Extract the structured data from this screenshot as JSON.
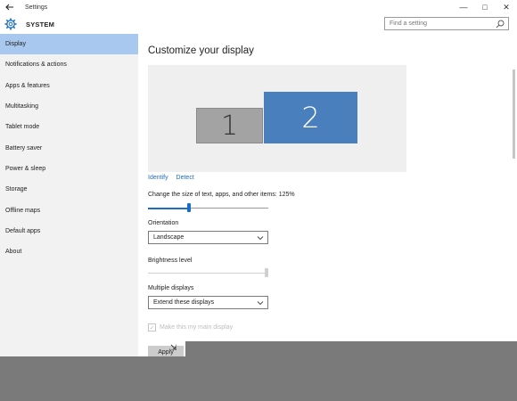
{
  "window": {
    "title": "Settings"
  },
  "titlebar": {
    "back_icon": "back-arrow-icon",
    "minimize": "—",
    "maximize": "□",
    "close": "✕"
  },
  "header": {
    "section": "SYSTEM",
    "search_placeholder": "Find a setting"
  },
  "sidebar": {
    "items": [
      {
        "label": "Display",
        "active": true
      },
      {
        "label": "Notifications & actions"
      },
      {
        "label": "Apps & features"
      },
      {
        "label": "Multitasking"
      },
      {
        "label": "Tablet mode"
      },
      {
        "label": "Battery saver"
      },
      {
        "label": "Power & sleep"
      },
      {
        "label": "Storage"
      },
      {
        "label": "Offline maps"
      },
      {
        "label": "Default apps"
      },
      {
        "label": "About"
      }
    ]
  },
  "main": {
    "title": "Customize your display",
    "monitors": [
      {
        "label": "1"
      },
      {
        "label": "2",
        "selected": true
      }
    ],
    "links": {
      "identify": "Identify",
      "detect": "Detect"
    },
    "scale": {
      "label": "Change the size of text, apps, and other items: 125%",
      "value_fraction": 0.34
    },
    "orientation": {
      "label": "Orientation",
      "value": "Landscape"
    },
    "brightness": {
      "label": "Brightness level",
      "value_fraction": 1.0
    },
    "multiple_displays": {
      "label": "Multiple displays",
      "value": "Extend these displays"
    },
    "main_display_checkbox": {
      "label": "Make this my main display",
      "checked": true,
      "disabled": true
    },
    "apply_button": {
      "label": "Apply"
    }
  },
  "colors": {
    "accent": "#1a6fc4",
    "selected_nav": "#a8c8ef",
    "monitor_selected": "#4a7fbd",
    "monitor_other": "#a3a3a3"
  }
}
